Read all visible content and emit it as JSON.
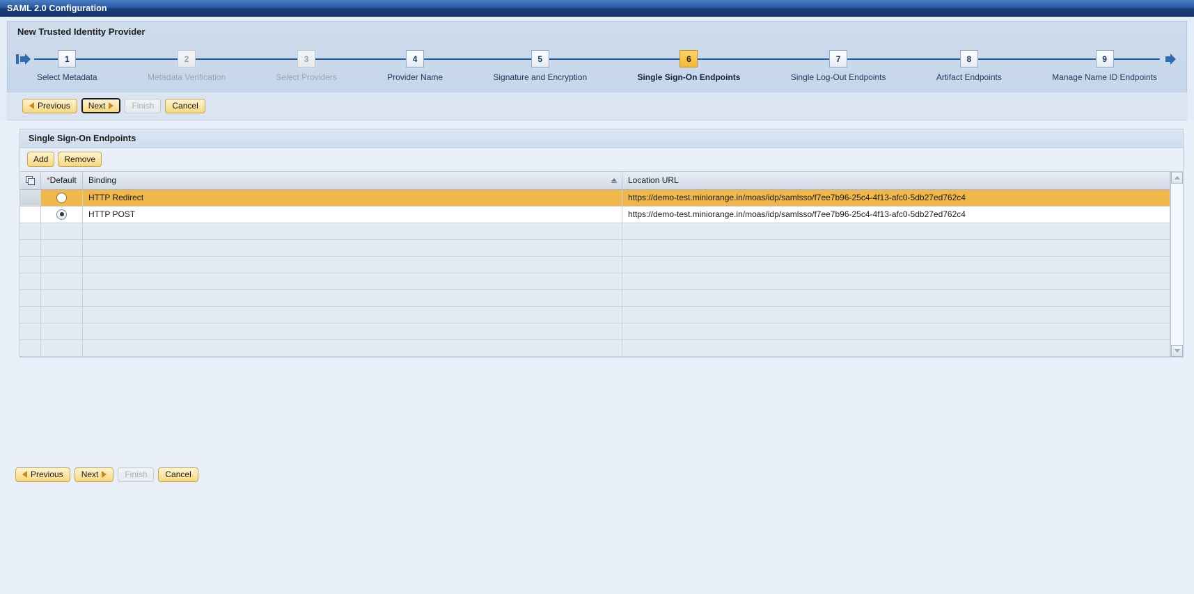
{
  "window": {
    "title": "SAML 2.0 Configuration"
  },
  "wizard": {
    "title": "New Trusted Identity Provider",
    "start_marker_icon": "wizard-start-arrow-icon",
    "end_marker_icon": "wizard-end-arrow-icon",
    "steps": [
      {
        "number": "1",
        "label": "Select Metadata",
        "state": "done"
      },
      {
        "number": "2",
        "label": "Metadata Verification",
        "state": "disabled"
      },
      {
        "number": "3",
        "label": "Select Providers",
        "state": "disabled"
      },
      {
        "number": "4",
        "label": "Provider Name",
        "state": "done"
      },
      {
        "number": "5",
        "label": "Signature and Encryption",
        "state": "done"
      },
      {
        "number": "6",
        "label": "Single Sign-On Endpoints",
        "state": "current"
      },
      {
        "number": "7",
        "label": "Single Log-Out Endpoints",
        "state": "done"
      },
      {
        "number": "8",
        "label": "Artifact Endpoints",
        "state": "done"
      },
      {
        "number": "9",
        "label": "Manage Name ID Endpoints",
        "state": "done"
      }
    ]
  },
  "toolbar": {
    "previous_label": "Previous",
    "next_label": "Next",
    "finish_label": "Finish",
    "cancel_label": "Cancel"
  },
  "panel": {
    "header": "Single Sign-On Endpoints",
    "add_label": "Add",
    "remove_label": "Remove"
  },
  "table": {
    "columns": {
      "select_all_icon": "select-all-columns-icon",
      "default_required_marker": "*",
      "default": "Default",
      "binding": "Binding",
      "location_url": "Location URL",
      "binding_sort": "ascending"
    },
    "rows": [
      {
        "default_checked": false,
        "binding": "HTTP Redirect",
        "location_url": "https://demo-test.miniorange.in/moas/idp/samlsso/f7ee7b96-25c4-4f13-afc0-5db27ed762c4",
        "selected": true
      },
      {
        "default_checked": true,
        "binding": "HTTP POST",
        "location_url": "https://demo-test.miniorange.in/moas/idp/samlsso/f7ee7b96-25c4-4f13-afc0-5db27ed762c4",
        "selected": false
      }
    ],
    "empty_row_count": 8
  },
  "scrollbar": {
    "up_icon": "scroll-up-arrow-icon",
    "down_icon": "scroll-down-arrow-icon"
  },
  "colors": {
    "title_bar": "#1b3f7e",
    "current_step": "#f5b733",
    "selected_row": "#f0b74a",
    "required_marker": "#d03a3a",
    "button": "#fbe6a8"
  }
}
